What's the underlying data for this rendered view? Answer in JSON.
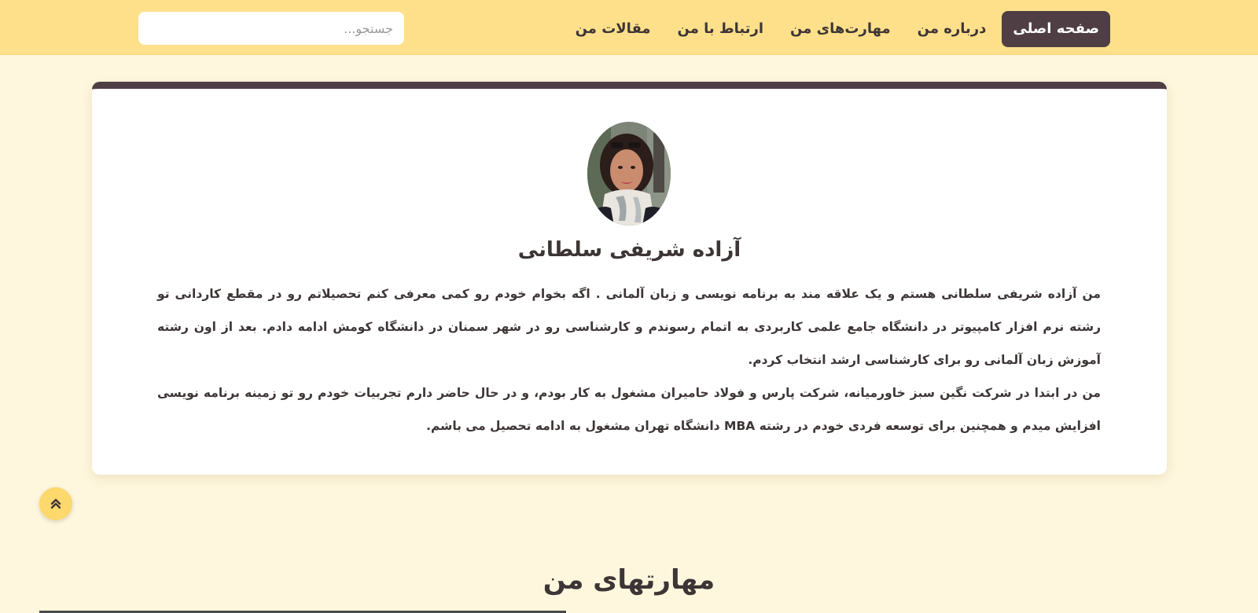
{
  "navbar": {
    "items": [
      {
        "label": "صفحه اصلی",
        "active": true
      },
      {
        "label": "درباره من",
        "active": false
      },
      {
        "label": "مهارت‌های من",
        "active": false
      },
      {
        "label": "ارتباط با من",
        "active": false
      },
      {
        "label": "مقالات من",
        "active": false
      }
    ],
    "search_placeholder": "جستجو..."
  },
  "about": {
    "name": "آزاده شریفی سلطانی",
    "bio_paragraph_1": "من آزاده شریفی سلطانی هستم و یک علاقه مند به برنامه نویسی و زبان آلمانی . اگه بخوام خودم رو کمی معرفی کنم تحصیلاتم رو در مقطع کاردانی تو رشته نرم افزار کامپیوتر در دانشگاه جامع علمی کاربردی به اتمام رسوندم و کارشناسی رو در شهر سمنان در دانشگاه کومش ادامه دادم. بعد از اون رشته آموزش زبان آلمانی رو برای کارشناسی ارشد انتخاب کردم.",
    "bio_paragraph_2": "من در ابتدا در شرکت نگین سبز خاورمیانه، شرکت پارس و فولاد حامیران مشغول به کار بودم، و در حال حاضر دارم تجربیات خودم رو تو زمینه برنامه نویسی افزایش میدم و همچنین برای توسعه فردی خودم در رشته MBA دانشگاه تهران مشغول به ادامه تحصیل می باشم."
  },
  "skills": {
    "title": "مهارتهای من"
  },
  "icons": {
    "scroll_top": "double-chevron-up-icon"
  },
  "colors": {
    "navbar_bg": "#fee08b",
    "page_bg": "#fef7de",
    "active_nav_bg": "#4f3f44",
    "card_top_border": "#4f3f44",
    "scroll_button_bg": "#fdd86d"
  }
}
